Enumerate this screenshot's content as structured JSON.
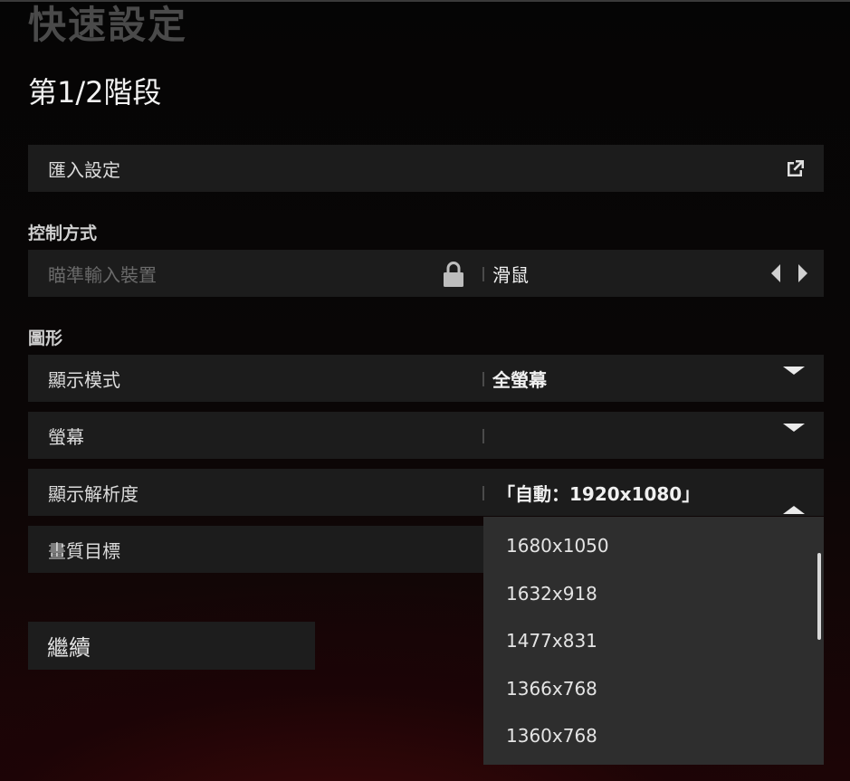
{
  "header": {
    "title": "快速設定",
    "stage": "第1/2階段"
  },
  "import_row": {
    "label": "匯入設定",
    "icon": "external-link-icon"
  },
  "controls": {
    "section": "控制方式",
    "aim_device": {
      "label": "瞄準輸入裝置",
      "value": "滑鼠",
      "locked": true
    }
  },
  "graphics": {
    "section": "圖形",
    "display_mode": {
      "label": "顯示模式",
      "value": "全螢幕"
    },
    "monitor": {
      "label": "螢幕",
      "value": ""
    },
    "resolution": {
      "label": "顯示解析度",
      "value": "「自動：1920x1080」"
    },
    "quality_target": {
      "label": "畫質目標"
    }
  },
  "resolution_options": [
    "1680x1050",
    "1632x918",
    "1477x831",
    "1366x768",
    "1360x768"
  ],
  "footer": {
    "continue_label": "繼續"
  }
}
